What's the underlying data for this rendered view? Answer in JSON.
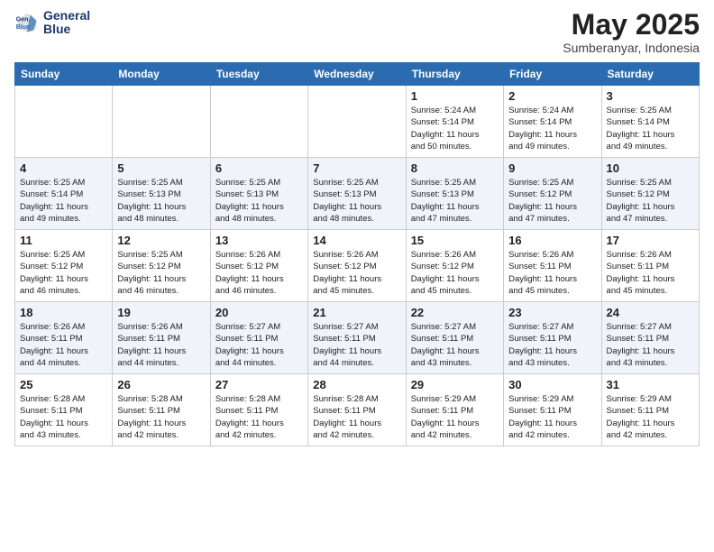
{
  "header": {
    "logo_line1": "General",
    "logo_line2": "Blue",
    "month_title": "May 2025",
    "location": "Sumberanyar, Indonesia"
  },
  "weekdays": [
    "Sunday",
    "Monday",
    "Tuesday",
    "Wednesday",
    "Thursday",
    "Friday",
    "Saturday"
  ],
  "weeks": [
    [
      {
        "day": "",
        "info": ""
      },
      {
        "day": "",
        "info": ""
      },
      {
        "day": "",
        "info": ""
      },
      {
        "day": "",
        "info": ""
      },
      {
        "day": "1",
        "info": "Sunrise: 5:24 AM\nSunset: 5:14 PM\nDaylight: 11 hours\nand 50 minutes."
      },
      {
        "day": "2",
        "info": "Sunrise: 5:24 AM\nSunset: 5:14 PM\nDaylight: 11 hours\nand 49 minutes."
      },
      {
        "day": "3",
        "info": "Sunrise: 5:25 AM\nSunset: 5:14 PM\nDaylight: 11 hours\nand 49 minutes."
      }
    ],
    [
      {
        "day": "4",
        "info": "Sunrise: 5:25 AM\nSunset: 5:14 PM\nDaylight: 11 hours\nand 49 minutes."
      },
      {
        "day": "5",
        "info": "Sunrise: 5:25 AM\nSunset: 5:13 PM\nDaylight: 11 hours\nand 48 minutes."
      },
      {
        "day": "6",
        "info": "Sunrise: 5:25 AM\nSunset: 5:13 PM\nDaylight: 11 hours\nand 48 minutes."
      },
      {
        "day": "7",
        "info": "Sunrise: 5:25 AM\nSunset: 5:13 PM\nDaylight: 11 hours\nand 48 minutes."
      },
      {
        "day": "8",
        "info": "Sunrise: 5:25 AM\nSunset: 5:13 PM\nDaylight: 11 hours\nand 47 minutes."
      },
      {
        "day": "9",
        "info": "Sunrise: 5:25 AM\nSunset: 5:12 PM\nDaylight: 11 hours\nand 47 minutes."
      },
      {
        "day": "10",
        "info": "Sunrise: 5:25 AM\nSunset: 5:12 PM\nDaylight: 11 hours\nand 47 minutes."
      }
    ],
    [
      {
        "day": "11",
        "info": "Sunrise: 5:25 AM\nSunset: 5:12 PM\nDaylight: 11 hours\nand 46 minutes."
      },
      {
        "day": "12",
        "info": "Sunrise: 5:25 AM\nSunset: 5:12 PM\nDaylight: 11 hours\nand 46 minutes."
      },
      {
        "day": "13",
        "info": "Sunrise: 5:26 AM\nSunset: 5:12 PM\nDaylight: 11 hours\nand 46 minutes."
      },
      {
        "day": "14",
        "info": "Sunrise: 5:26 AM\nSunset: 5:12 PM\nDaylight: 11 hours\nand 45 minutes."
      },
      {
        "day": "15",
        "info": "Sunrise: 5:26 AM\nSunset: 5:12 PM\nDaylight: 11 hours\nand 45 minutes."
      },
      {
        "day": "16",
        "info": "Sunrise: 5:26 AM\nSunset: 5:11 PM\nDaylight: 11 hours\nand 45 minutes."
      },
      {
        "day": "17",
        "info": "Sunrise: 5:26 AM\nSunset: 5:11 PM\nDaylight: 11 hours\nand 45 minutes."
      }
    ],
    [
      {
        "day": "18",
        "info": "Sunrise: 5:26 AM\nSunset: 5:11 PM\nDaylight: 11 hours\nand 44 minutes."
      },
      {
        "day": "19",
        "info": "Sunrise: 5:26 AM\nSunset: 5:11 PM\nDaylight: 11 hours\nand 44 minutes."
      },
      {
        "day": "20",
        "info": "Sunrise: 5:27 AM\nSunset: 5:11 PM\nDaylight: 11 hours\nand 44 minutes."
      },
      {
        "day": "21",
        "info": "Sunrise: 5:27 AM\nSunset: 5:11 PM\nDaylight: 11 hours\nand 44 minutes."
      },
      {
        "day": "22",
        "info": "Sunrise: 5:27 AM\nSunset: 5:11 PM\nDaylight: 11 hours\nand 43 minutes."
      },
      {
        "day": "23",
        "info": "Sunrise: 5:27 AM\nSunset: 5:11 PM\nDaylight: 11 hours\nand 43 minutes."
      },
      {
        "day": "24",
        "info": "Sunrise: 5:27 AM\nSunset: 5:11 PM\nDaylight: 11 hours\nand 43 minutes."
      }
    ],
    [
      {
        "day": "25",
        "info": "Sunrise: 5:28 AM\nSunset: 5:11 PM\nDaylight: 11 hours\nand 43 minutes."
      },
      {
        "day": "26",
        "info": "Sunrise: 5:28 AM\nSunset: 5:11 PM\nDaylight: 11 hours\nand 42 minutes."
      },
      {
        "day": "27",
        "info": "Sunrise: 5:28 AM\nSunset: 5:11 PM\nDaylight: 11 hours\nand 42 minutes."
      },
      {
        "day": "28",
        "info": "Sunrise: 5:28 AM\nSunset: 5:11 PM\nDaylight: 11 hours\nand 42 minutes."
      },
      {
        "day": "29",
        "info": "Sunrise: 5:29 AM\nSunset: 5:11 PM\nDaylight: 11 hours\nand 42 minutes."
      },
      {
        "day": "30",
        "info": "Sunrise: 5:29 AM\nSunset: 5:11 PM\nDaylight: 11 hours\nand 42 minutes."
      },
      {
        "day": "31",
        "info": "Sunrise: 5:29 AM\nSunset: 5:11 PM\nDaylight: 11 hours\nand 42 minutes."
      }
    ]
  ]
}
